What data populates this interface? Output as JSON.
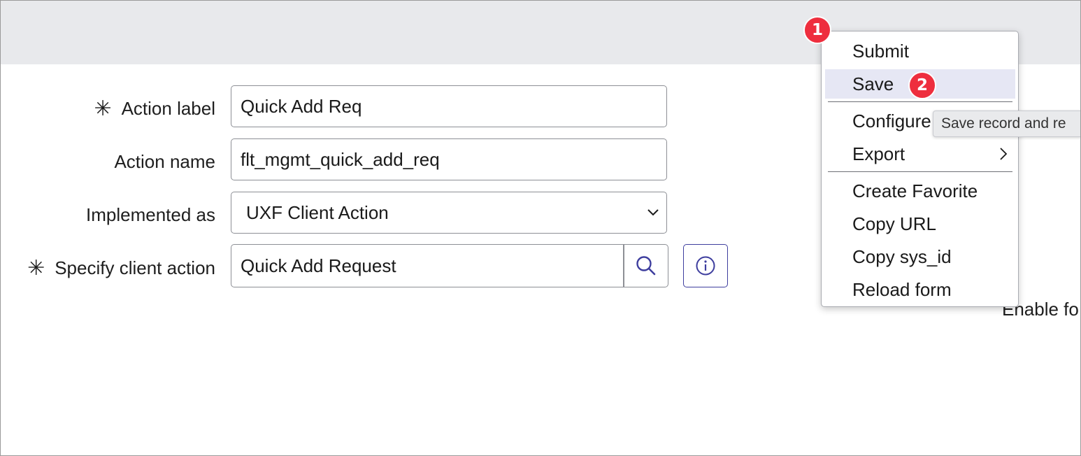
{
  "form": {
    "fields": [
      {
        "label": "Action label",
        "value": "Quick Add Req",
        "required": true
      },
      {
        "label": "Action name",
        "value": "flt_mgmt_quick_add_req",
        "required": false
      },
      {
        "label": "Implemented as",
        "value": "UXF Client Action",
        "required": false
      },
      {
        "label": "Specify client action",
        "value": "Quick Add Request",
        "required": true
      }
    ],
    "required_marker": "✳"
  },
  "menu": {
    "items": [
      {
        "label": "Submit"
      },
      {
        "label": "Save"
      },
      {
        "label": "Configure"
      },
      {
        "label": "Export"
      },
      {
        "label": "Create Favorite"
      },
      {
        "label": "Copy URL"
      },
      {
        "label": "Copy sys_id"
      },
      {
        "label": "Reload form"
      }
    ],
    "hovered": "Save"
  },
  "tooltip": {
    "text": "Save record and re"
  },
  "right_panel": {
    "partial_text": "Enable fo"
  },
  "badges": [
    {
      "number": "1"
    },
    {
      "number": "2"
    }
  ],
  "colors": {
    "header_bg": "#e8e9ec",
    "badge_red": "#ee2e3e",
    "menu_hover": "#e6e7f4",
    "info_border": "#3e3e9e"
  },
  "icons": {
    "search": "search-icon",
    "info": "info-icon",
    "dropdown": "chevron-down-icon",
    "submenu": "chevron-right-icon"
  }
}
